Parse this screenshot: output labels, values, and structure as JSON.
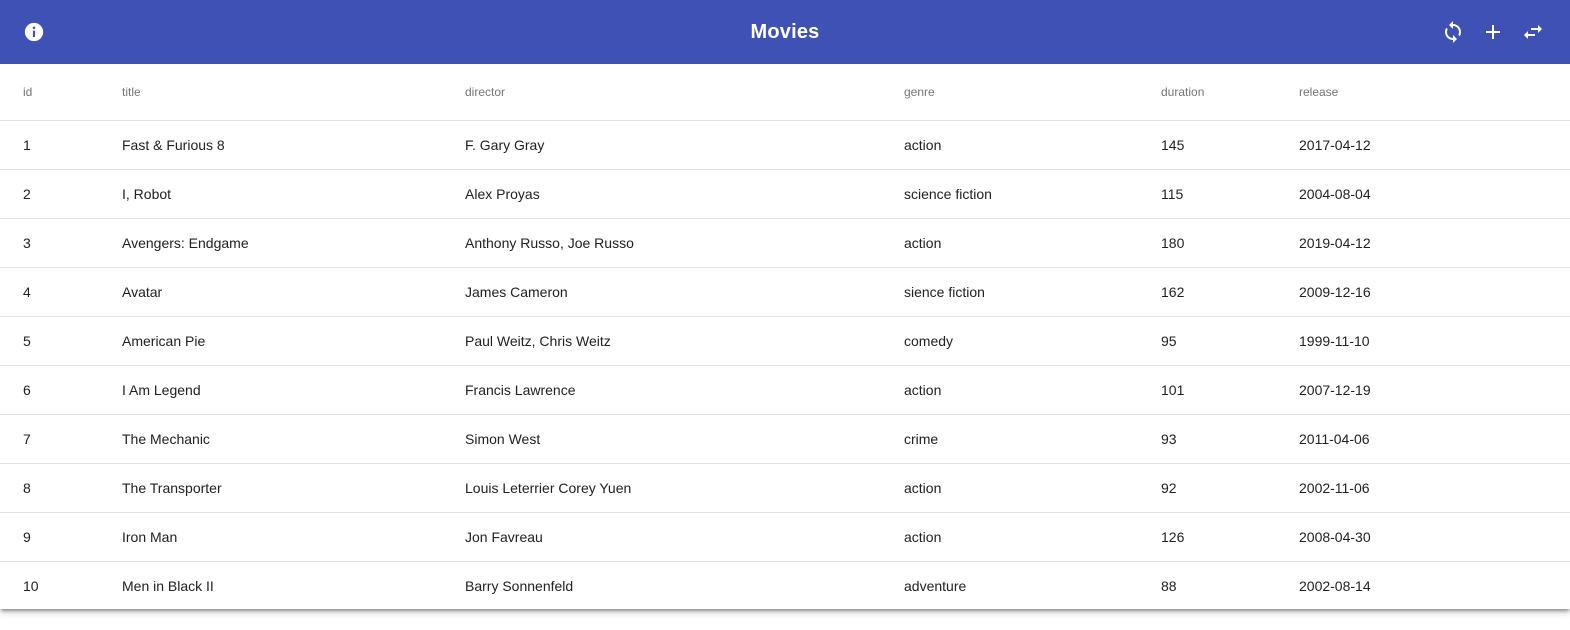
{
  "toolbar": {
    "title": "Movies",
    "background_color": "#3f51b5",
    "icons": {
      "info": "info-icon",
      "refresh": "refresh-icon",
      "add": "add-icon",
      "swap": "swap-icon"
    }
  },
  "table": {
    "columns": [
      "id",
      "title",
      "director",
      "genre",
      "duration",
      "release"
    ],
    "rows": [
      [
        "1",
        "Fast & Furious 8",
        "F. Gary Gray",
        "action",
        "145",
        "2017-04-12"
      ],
      [
        "2",
        "I, Robot",
        "Alex Proyas",
        "science fiction",
        "115",
        "2004-08-04"
      ],
      [
        "3",
        "Avengers: Endgame",
        "Anthony Russo, Joe Russo",
        "action",
        "180",
        "2019-04-12"
      ],
      [
        "4",
        "Avatar",
        "James Cameron",
        "sience fiction",
        "162",
        "2009-12-16"
      ],
      [
        "5",
        "American Pie",
        "Paul Weitz, Chris Weitz",
        "comedy",
        "95",
        "1999-11-10"
      ],
      [
        "6",
        "I Am Legend",
        "Francis Lawrence",
        "action",
        "101",
        "2007-12-19"
      ],
      [
        "7",
        "The Mechanic",
        "Simon West",
        "crime",
        "93",
        "2011-04-06"
      ],
      [
        "8",
        "The Transporter",
        "Louis Leterrier Corey Yuen",
        "action",
        "92",
        "2002-11-06"
      ],
      [
        "9",
        "Iron Man",
        "Jon Favreau",
        "action",
        "126",
        "2008-04-30"
      ],
      [
        "10",
        "Men in Black II",
        "Barry Sonnenfeld",
        "adventure",
        "88",
        "2002-08-14"
      ]
    ]
  }
}
